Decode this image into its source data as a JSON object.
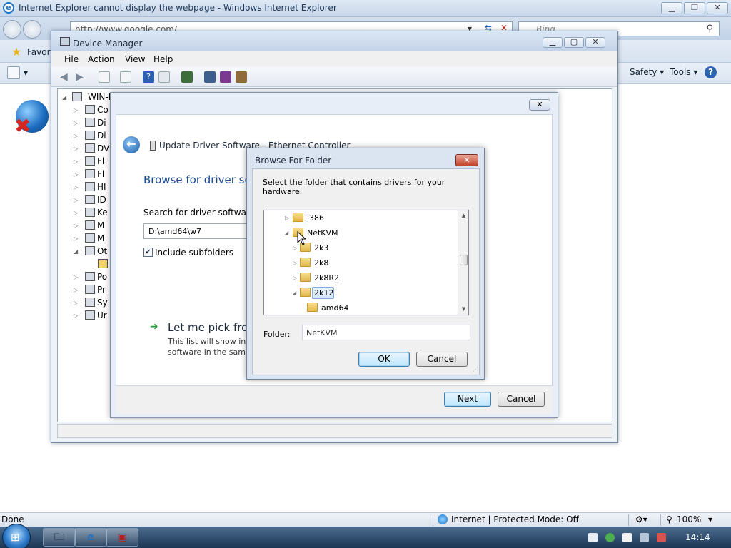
{
  "ie": {
    "title": "Internet Explorer cannot display the webpage - Windows Internet Explorer",
    "address": "http://www.google.com/",
    "search_placeholder": "Bing",
    "favorites_label": "Favori",
    "commands": {
      "safety": "Safety ▾",
      "tools": "Tools ▾"
    },
    "status": {
      "done": "Done",
      "zone": "Internet | Protected Mode: Off",
      "zoom": "100%"
    }
  },
  "device_manager": {
    "title": "Device Manager",
    "menu": [
      "File",
      "Action",
      "View",
      "Help"
    ],
    "tree_root": "WIN-I",
    "tree_items": [
      "Co",
      "Di",
      "Di",
      "DV",
      "Fl",
      "Fl",
      "HI",
      "ID",
      "Ke",
      "M",
      "M",
      "Ot",
      "",
      "Po",
      "Pr",
      "Sy",
      "Ur"
    ]
  },
  "wizard": {
    "title": "Update Driver Software - Ethernet Controller",
    "heading": "Browse for driver sof",
    "search_label": "Search for driver software in",
    "path_value": "D:\\amd64\\w7",
    "include_subfolders": "Include subfolders",
    "pick_title": "Let me pick from",
    "pick_desc_1": "This list will show inst",
    "pick_desc_2": "software in the same",
    "next_label": "Next",
    "cancel_label": "Cancel"
  },
  "browse_folder": {
    "title": "Browse For Folder",
    "message": "Select the folder that contains drivers for your hardware.",
    "tree": [
      {
        "label": "i386",
        "expander": "▷"
      },
      {
        "label": "NetKVM",
        "expander": "◢"
      },
      {
        "label": "2k3",
        "expander": "▷"
      },
      {
        "label": "2k8",
        "expander": "▷"
      },
      {
        "label": "2k8R2",
        "expander": "▷"
      },
      {
        "label": "2k12",
        "expander": "◢"
      },
      {
        "label": "amd64",
        "expander": ""
      }
    ],
    "folder_label": "Folder:",
    "folder_value": "NetKVM",
    "ok_label": "OK",
    "cancel_label": "Cancel"
  },
  "taskbar": {
    "clock": "14:14"
  }
}
